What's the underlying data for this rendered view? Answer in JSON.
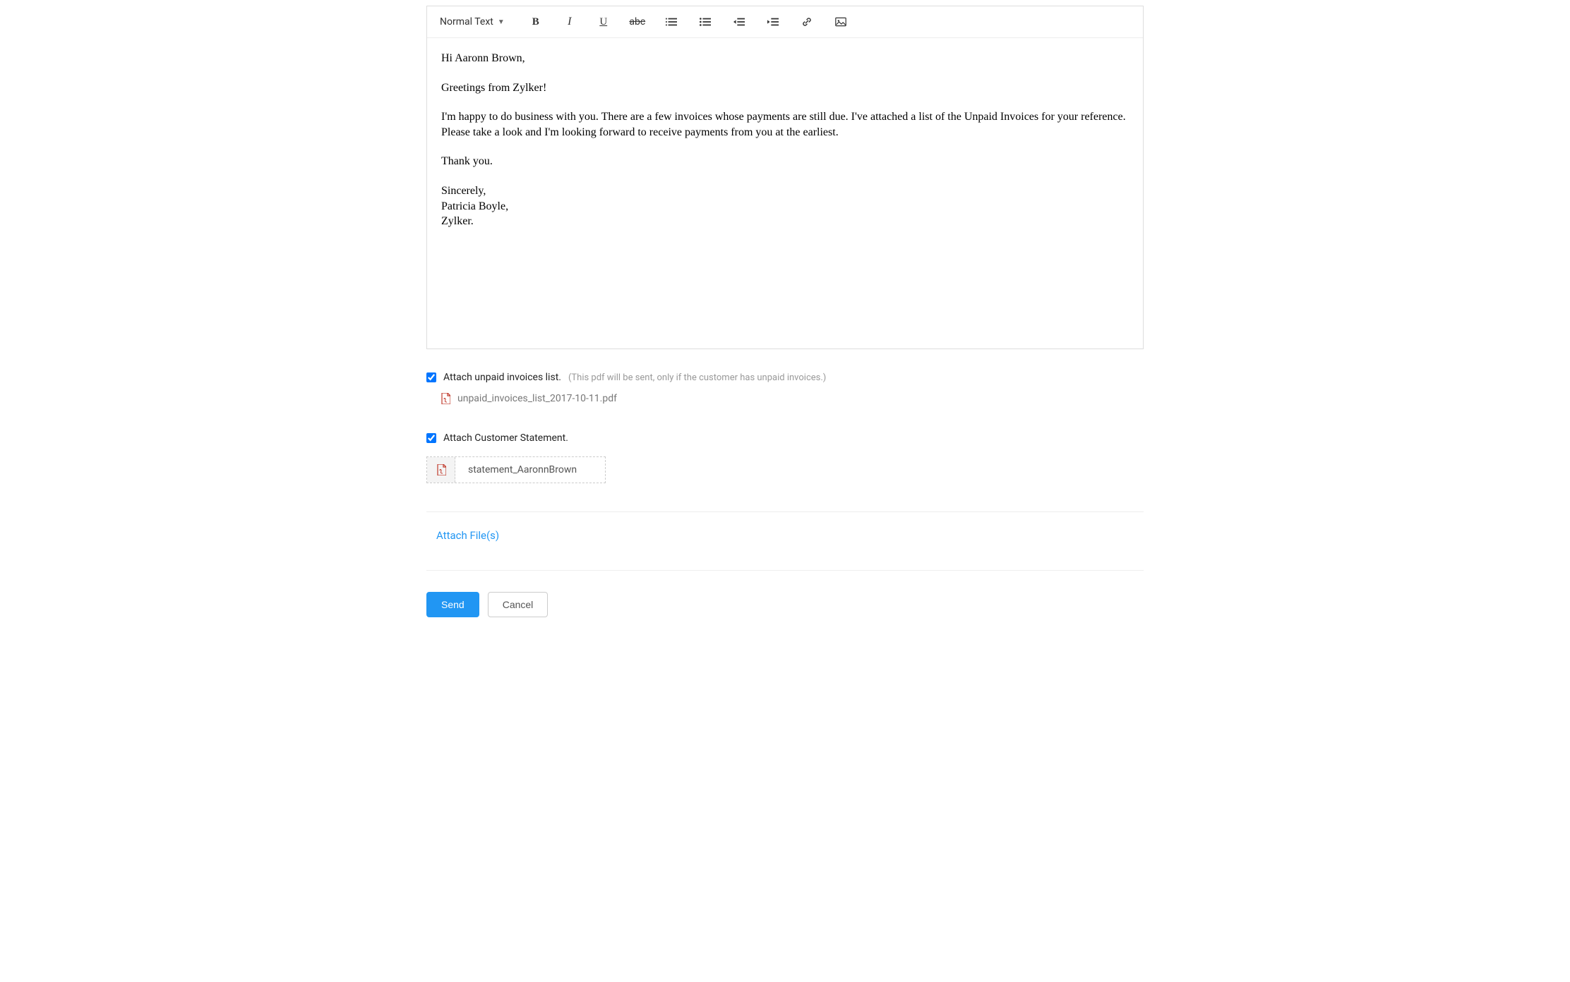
{
  "toolbar": {
    "format_label": "Normal Text"
  },
  "email": {
    "greeting": "Hi Aaronn Brown,",
    "intro": "Greetings from Zylker!",
    "body": "I'm happy to do business with you. There are a few invoices whose payments are still due. I've attached a list of the Unpaid Invoices for your reference. Please take a look and I'm looking forward to receive payments from you at the earliest.",
    "thanks": "Thank you.",
    "signoff": "Sincerely,",
    "sender_name": "Patricia Boyle,",
    "sender_company": "Zylker."
  },
  "attachments": {
    "unpaid_label": "Attach unpaid invoices list.",
    "unpaid_hint": "(This pdf will be sent, only if the customer has unpaid invoices.)",
    "unpaid_filename": "unpaid_invoices_list_2017-10-11.pdf",
    "statement_label": "Attach Customer Statement.",
    "statement_filename": "statement_AaronnBrown"
  },
  "actions": {
    "attach_files": "Attach File(s)",
    "send": "Send",
    "cancel": "Cancel"
  }
}
